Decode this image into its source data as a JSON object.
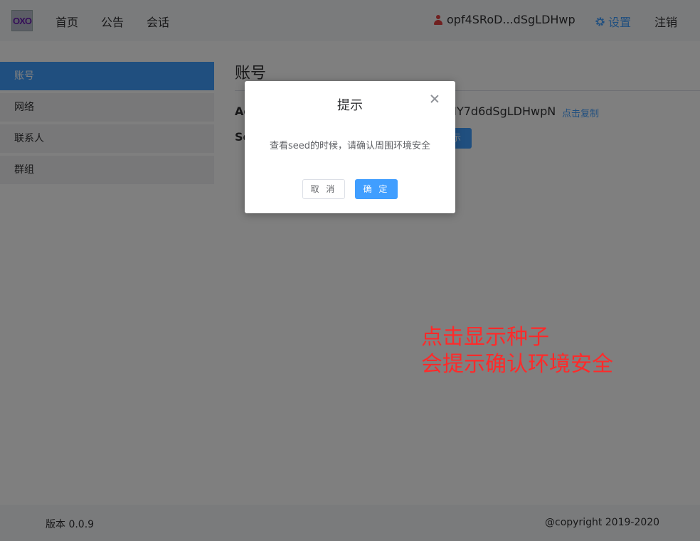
{
  "header": {
    "logo_text": "OXO",
    "nav": [
      "首页",
      "公告",
      "会话"
    ],
    "user_name": "opf4SRoD...dSgLDHwp",
    "settings_label": "设置",
    "logout_label": "注销"
  },
  "sidebar": {
    "items": [
      {
        "label": "账号",
        "active": true
      },
      {
        "label": "网络",
        "active": false
      },
      {
        "label": "联系人",
        "active": false
      },
      {
        "label": "群组",
        "active": false
      }
    ]
  },
  "main": {
    "title": "账号",
    "address_label": "Ac",
    "address_value": "NY7d6dSgLDHwpN",
    "copy_label": "点击复制",
    "seed_label": "Se",
    "show_button": "示"
  },
  "footer": {
    "version": "版本 0.0.9",
    "copyright": "@copyright 2019-2020"
  },
  "dialog": {
    "title": "提示",
    "message": "查看seed的时候，请确认周围环境安全",
    "cancel_label": "取 消",
    "ok_label": "确 定"
  },
  "annotation": {
    "line1": "点击显示种子",
    "line2": "会提示确认环境安全"
  },
  "colors": {
    "accent": "#409eff",
    "annotation": "#ff2a2a",
    "user_icon": "#e04040"
  }
}
